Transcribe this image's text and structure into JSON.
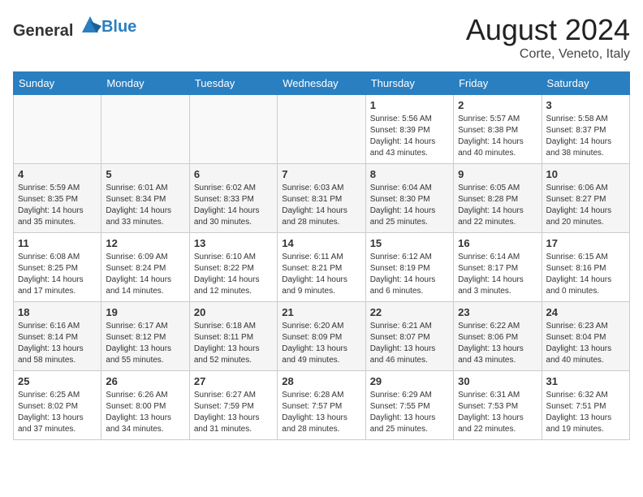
{
  "header": {
    "logo_general": "General",
    "logo_blue": "Blue",
    "month_year": "August 2024",
    "location": "Corte, Veneto, Italy"
  },
  "days_of_week": [
    "Sunday",
    "Monday",
    "Tuesday",
    "Wednesday",
    "Thursday",
    "Friday",
    "Saturday"
  ],
  "weeks": [
    [
      {
        "day": "",
        "info": ""
      },
      {
        "day": "",
        "info": ""
      },
      {
        "day": "",
        "info": ""
      },
      {
        "day": "",
        "info": ""
      },
      {
        "day": "1",
        "info": "Sunrise: 5:56 AM\nSunset: 8:39 PM\nDaylight: 14 hours\nand 43 minutes."
      },
      {
        "day": "2",
        "info": "Sunrise: 5:57 AM\nSunset: 8:38 PM\nDaylight: 14 hours\nand 40 minutes."
      },
      {
        "day": "3",
        "info": "Sunrise: 5:58 AM\nSunset: 8:37 PM\nDaylight: 14 hours\nand 38 minutes."
      }
    ],
    [
      {
        "day": "4",
        "info": "Sunrise: 5:59 AM\nSunset: 8:35 PM\nDaylight: 14 hours\nand 35 minutes."
      },
      {
        "day": "5",
        "info": "Sunrise: 6:01 AM\nSunset: 8:34 PM\nDaylight: 14 hours\nand 33 minutes."
      },
      {
        "day": "6",
        "info": "Sunrise: 6:02 AM\nSunset: 8:33 PM\nDaylight: 14 hours\nand 30 minutes."
      },
      {
        "day": "7",
        "info": "Sunrise: 6:03 AM\nSunset: 8:31 PM\nDaylight: 14 hours\nand 28 minutes."
      },
      {
        "day": "8",
        "info": "Sunrise: 6:04 AM\nSunset: 8:30 PM\nDaylight: 14 hours\nand 25 minutes."
      },
      {
        "day": "9",
        "info": "Sunrise: 6:05 AM\nSunset: 8:28 PM\nDaylight: 14 hours\nand 22 minutes."
      },
      {
        "day": "10",
        "info": "Sunrise: 6:06 AM\nSunset: 8:27 PM\nDaylight: 14 hours\nand 20 minutes."
      }
    ],
    [
      {
        "day": "11",
        "info": "Sunrise: 6:08 AM\nSunset: 8:25 PM\nDaylight: 14 hours\nand 17 minutes."
      },
      {
        "day": "12",
        "info": "Sunrise: 6:09 AM\nSunset: 8:24 PM\nDaylight: 14 hours\nand 14 minutes."
      },
      {
        "day": "13",
        "info": "Sunrise: 6:10 AM\nSunset: 8:22 PM\nDaylight: 14 hours\nand 12 minutes."
      },
      {
        "day": "14",
        "info": "Sunrise: 6:11 AM\nSunset: 8:21 PM\nDaylight: 14 hours\nand 9 minutes."
      },
      {
        "day": "15",
        "info": "Sunrise: 6:12 AM\nSunset: 8:19 PM\nDaylight: 14 hours\nand 6 minutes."
      },
      {
        "day": "16",
        "info": "Sunrise: 6:14 AM\nSunset: 8:17 PM\nDaylight: 14 hours\nand 3 minutes."
      },
      {
        "day": "17",
        "info": "Sunrise: 6:15 AM\nSunset: 8:16 PM\nDaylight: 14 hours\nand 0 minutes."
      }
    ],
    [
      {
        "day": "18",
        "info": "Sunrise: 6:16 AM\nSunset: 8:14 PM\nDaylight: 13 hours\nand 58 minutes."
      },
      {
        "day": "19",
        "info": "Sunrise: 6:17 AM\nSunset: 8:12 PM\nDaylight: 13 hours\nand 55 minutes."
      },
      {
        "day": "20",
        "info": "Sunrise: 6:18 AM\nSunset: 8:11 PM\nDaylight: 13 hours\nand 52 minutes."
      },
      {
        "day": "21",
        "info": "Sunrise: 6:20 AM\nSunset: 8:09 PM\nDaylight: 13 hours\nand 49 minutes."
      },
      {
        "day": "22",
        "info": "Sunrise: 6:21 AM\nSunset: 8:07 PM\nDaylight: 13 hours\nand 46 minutes."
      },
      {
        "day": "23",
        "info": "Sunrise: 6:22 AM\nSunset: 8:06 PM\nDaylight: 13 hours\nand 43 minutes."
      },
      {
        "day": "24",
        "info": "Sunrise: 6:23 AM\nSunset: 8:04 PM\nDaylight: 13 hours\nand 40 minutes."
      }
    ],
    [
      {
        "day": "25",
        "info": "Sunrise: 6:25 AM\nSunset: 8:02 PM\nDaylight: 13 hours\nand 37 minutes."
      },
      {
        "day": "26",
        "info": "Sunrise: 6:26 AM\nSunset: 8:00 PM\nDaylight: 13 hours\nand 34 minutes."
      },
      {
        "day": "27",
        "info": "Sunrise: 6:27 AM\nSunset: 7:59 PM\nDaylight: 13 hours\nand 31 minutes."
      },
      {
        "day": "28",
        "info": "Sunrise: 6:28 AM\nSunset: 7:57 PM\nDaylight: 13 hours\nand 28 minutes."
      },
      {
        "day": "29",
        "info": "Sunrise: 6:29 AM\nSunset: 7:55 PM\nDaylight: 13 hours\nand 25 minutes."
      },
      {
        "day": "30",
        "info": "Sunrise: 6:31 AM\nSunset: 7:53 PM\nDaylight: 13 hours\nand 22 minutes."
      },
      {
        "day": "31",
        "info": "Sunrise: 6:32 AM\nSunset: 7:51 PM\nDaylight: 13 hours\nand 19 minutes."
      }
    ]
  ]
}
